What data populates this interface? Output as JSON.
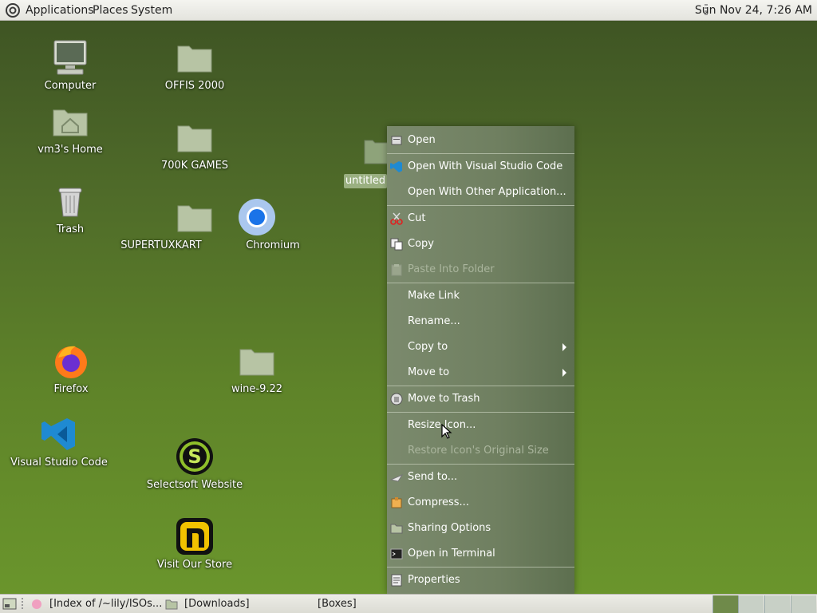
{
  "top_panel": {
    "menus": [
      "Applications",
      "Places",
      "System"
    ],
    "clock": "Sun Nov 24,  7:26 AM"
  },
  "desktop": {
    "icons": [
      {
        "label": "Computer",
        "icon": "computer-icon"
      },
      {
        "label": "vm3's Home",
        "icon": "home-folder-icon"
      },
      {
        "label": "Trash",
        "icon": "trash-icon"
      },
      {
        "label": "Firefox",
        "icon": "firefox-icon"
      },
      {
        "label": "Visual Studio Code",
        "icon": "vscode-icon"
      },
      {
        "label": "OFFIS 2000",
        "icon": "folder-icon"
      },
      {
        "label": "700K GAMES",
        "icon": "folder-icon"
      },
      {
        "label": "SUPERTUXKART",
        "icon": "folder-icon"
      },
      {
        "label": "Chromium",
        "icon": "chromium-icon"
      },
      {
        "label": "wine-9.22",
        "icon": "folder-icon"
      },
      {
        "label": "Selectsoft Website",
        "icon": "selectsoft-icon"
      },
      {
        "label": "Visit Our Store",
        "icon": "store-icon"
      }
    ],
    "selected_icon_label": "untitled"
  },
  "context_menu": {
    "items": [
      {
        "label": "Open",
        "icon": "open-icon",
        "disabled": false
      },
      {
        "label": "Open With Visual Studio Code",
        "icon": "vscode-icon",
        "disabled": false
      },
      {
        "label": "Open With Other Application...",
        "icon": "",
        "disabled": false
      },
      {
        "label": "Cut",
        "icon": "scissors-icon",
        "disabled": false
      },
      {
        "label": "Copy",
        "icon": "copy-icon",
        "disabled": false
      },
      {
        "label": "Paste Into Folder",
        "icon": "paste-icon",
        "disabled": true
      },
      {
        "label": "Make Link",
        "icon": "",
        "disabled": false
      },
      {
        "label": "Rename...",
        "icon": "",
        "disabled": false
      },
      {
        "label": "Copy to",
        "icon": "",
        "disabled": false,
        "submenu": true
      },
      {
        "label": "Move to",
        "icon": "",
        "disabled": false,
        "submenu": true
      },
      {
        "label": "Move to Trash",
        "icon": "trash-icon",
        "disabled": false
      },
      {
        "label": "Resize Icon...",
        "icon": "",
        "disabled": false
      },
      {
        "label": "Restore Icon's Original Size",
        "icon": "",
        "disabled": true
      },
      {
        "label": "Send to...",
        "icon": "send-icon",
        "disabled": false
      },
      {
        "label": "Compress...",
        "icon": "archive-icon",
        "disabled": false
      },
      {
        "label": "Sharing Options",
        "icon": "share-folder-icon",
        "disabled": false
      },
      {
        "label": "Open in Terminal",
        "icon": "terminal-icon",
        "disabled": false
      },
      {
        "label": "Properties",
        "icon": "properties-icon",
        "disabled": false
      }
    ]
  },
  "bottom_panel": {
    "tasks": [
      "[Index of /~lily/ISOs...",
      "[Downloads]",
      "[Boxes]"
    ]
  },
  "colors": {
    "desktop_top": "#3f5524",
    "desktop_bottom": "#6a952c",
    "menu_bg": "#6f7f60",
    "folder": "#b7c4a4"
  }
}
